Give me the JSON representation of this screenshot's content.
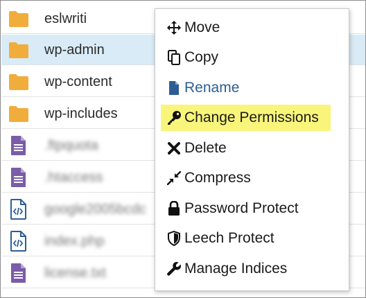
{
  "files": [
    {
      "name": "eslwriti",
      "type": "folder",
      "selected": false,
      "blurred": false
    },
    {
      "name": "wp-admin",
      "type": "folder",
      "selected": true,
      "blurred": false
    },
    {
      "name": "wp-content",
      "type": "folder",
      "selected": false,
      "blurred": false
    },
    {
      "name": "wp-includes",
      "type": "folder",
      "selected": false,
      "blurred": false
    },
    {
      "name": ".ftpquota",
      "type": "text-file",
      "selected": false,
      "blurred": true
    },
    {
      "name": ".htaccess",
      "type": "text-file",
      "selected": false,
      "blurred": true
    },
    {
      "name": "google2005bcdc",
      "type": "code-file",
      "selected": false,
      "blurred": true
    },
    {
      "name": "index.php",
      "type": "code-file",
      "selected": false,
      "blurred": true
    },
    {
      "name": "license.txt",
      "type": "text-file",
      "selected": false,
      "blurred": true
    }
  ],
  "context_menu": {
    "items": [
      {
        "label": "Move",
        "icon": "move-icon"
      },
      {
        "label": "Copy",
        "icon": "copy-icon"
      },
      {
        "label": "Rename",
        "icon": "file-icon"
      },
      {
        "label": "Change Permissions",
        "icon": "key-icon"
      },
      {
        "label": "Delete",
        "icon": "x-icon"
      },
      {
        "label": "Compress",
        "icon": "compress-icon"
      },
      {
        "label": "Password Protect",
        "icon": "lock-icon"
      },
      {
        "label": "Leech Protect",
        "icon": "shield-icon"
      },
      {
        "label": "Manage Indices",
        "icon": "wrench-icon"
      }
    ]
  },
  "colors": {
    "folder": "#f0ad3c",
    "text_file": "#7a5ca8",
    "code_file": "#2c5e94",
    "selected_row": "#d9ebf7",
    "highlight": "#f9f57a",
    "rename_link": "#2c5e94"
  }
}
